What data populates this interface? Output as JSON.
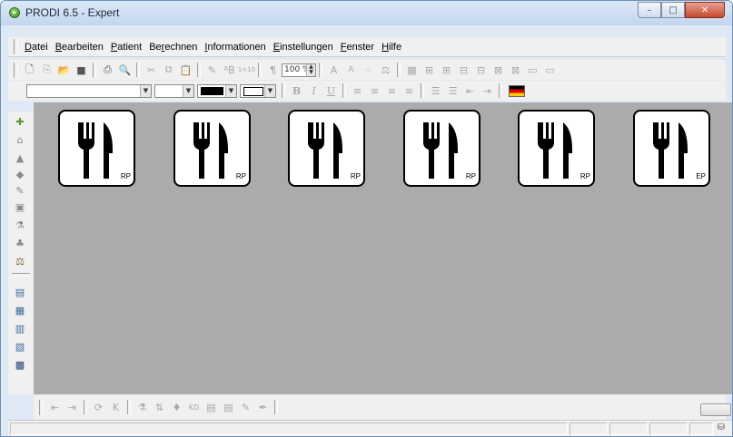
{
  "window": {
    "title": "PRODI 6.5 - Expert",
    "controls": {
      "minimize": "–",
      "maximize": "□",
      "close": "✕"
    }
  },
  "menubar": {
    "items": [
      {
        "underline": "D",
        "rest": "atei"
      },
      {
        "underline": "B",
        "rest": "earbeiten"
      },
      {
        "underline": "P",
        "rest": "atient"
      },
      {
        "pre": "Be",
        "underline": "r",
        "rest": "echnen"
      },
      {
        "underline": "I",
        "rest": "nformationen"
      },
      {
        "underline": "E",
        "rest": "instellungen"
      },
      {
        "underline": "F",
        "rest": "enster"
      },
      {
        "underline": "H",
        "rest": "ilfe"
      }
    ]
  },
  "toolbar": {
    "zoom": "100 %",
    "paragraph_mark": "¶",
    "line_spacing": "1=10"
  },
  "format_toolbar": {
    "bold": "B",
    "italic": "I",
    "underline": "U",
    "language_flag": "German"
  },
  "meals": [
    {
      "label": "RP"
    },
    {
      "label": "RP"
    },
    {
      "label": "RP"
    },
    {
      "label": "RP"
    },
    {
      "label": "RP"
    },
    {
      "label": "EP"
    }
  ],
  "colors": {
    "workspace": "#ababab",
    "toolbar": "#f0f0f0",
    "titlebar": "#c9dbf0",
    "close": "#c6492f"
  }
}
